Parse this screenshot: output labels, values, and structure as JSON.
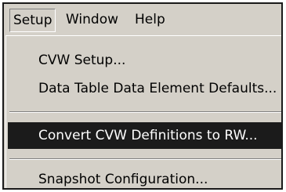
{
  "menubar": {
    "items": [
      {
        "label": "Setup"
      },
      {
        "label": "Window"
      },
      {
        "label": "Help"
      }
    ]
  },
  "dropdown": {
    "items": [
      {
        "label": "CVW Setup..."
      },
      {
        "label": "Data Table Data Element Defaults..."
      },
      {
        "label": "Convert CVW Definitions to RW..."
      },
      {
        "label": "Snapshot Configuration..."
      }
    ],
    "highlighted_index": 2,
    "highlight_color": "#1b1b1b"
  }
}
